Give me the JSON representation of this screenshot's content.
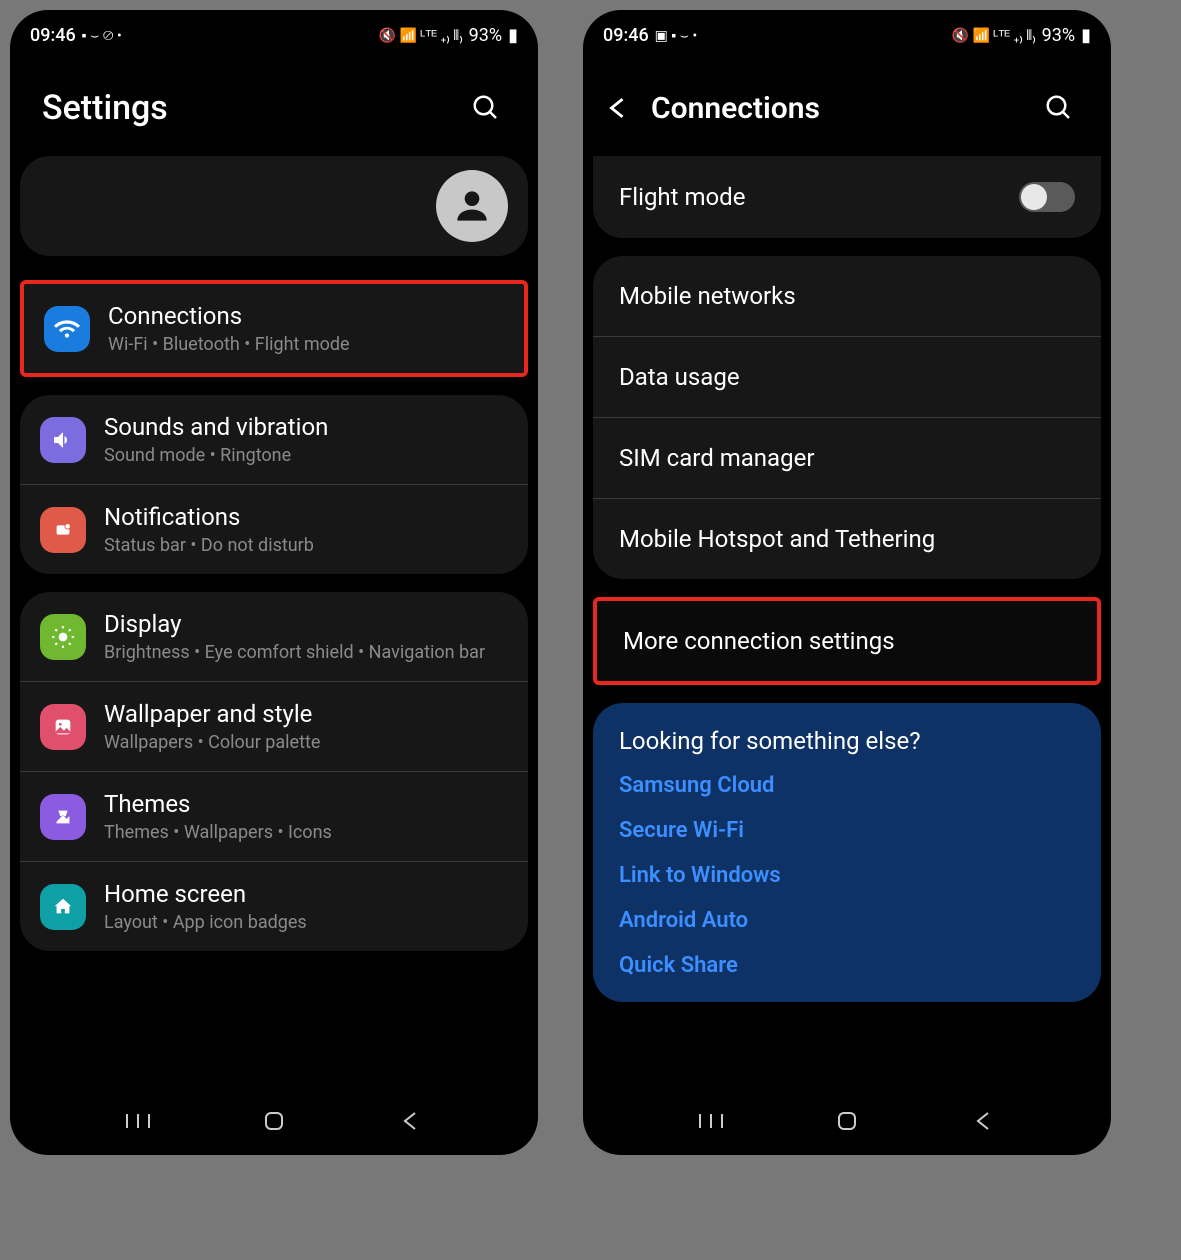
{
  "left": {
    "status": {
      "time": "09:46",
      "battery": "93%"
    },
    "title": "Settings",
    "items": [
      {
        "title": "Connections",
        "sub": "Wi-Fi  •  Bluetooth  •  Flight mode",
        "icon": "wifi-icon",
        "color": "ic-blue",
        "highlight": true
      },
      {
        "title": "Sounds and vibration",
        "sub": "Sound mode  •  Ringtone",
        "icon": "sound-icon",
        "color": "ic-purple"
      },
      {
        "title": "Notifications",
        "sub": "Status bar  •  Do not disturb",
        "icon": "notification-icon",
        "color": "ic-coral"
      },
      {
        "title": "Display",
        "sub": "Brightness  •  Eye comfort shield  •  Navigation bar",
        "icon": "display-icon",
        "color": "ic-green"
      },
      {
        "title": "Wallpaper and style",
        "sub": "Wallpapers  •  Colour palette",
        "icon": "wallpaper-icon",
        "color": "ic-pink"
      },
      {
        "title": "Themes",
        "sub": "Themes  •  Wallpapers  •  Icons",
        "icon": "themes-icon",
        "color": "ic-violet"
      },
      {
        "title": "Home screen",
        "sub": "Layout  •  App icon badges",
        "icon": "home-icon",
        "color": "ic-teal"
      }
    ]
  },
  "right": {
    "status": {
      "time": "09:46",
      "battery": "93%"
    },
    "title": "Connections",
    "flight_mode": "Flight mode",
    "group1": [
      "Mobile networks",
      "Data usage",
      "SIM card manager",
      "Mobile Hotspot and Tethering"
    ],
    "more": "More connection settings",
    "lookingTitle": "Looking for something else?",
    "links": [
      "Samsung Cloud",
      "Secure Wi-Fi",
      "Link to Windows",
      "Android Auto",
      "Quick Share"
    ]
  }
}
